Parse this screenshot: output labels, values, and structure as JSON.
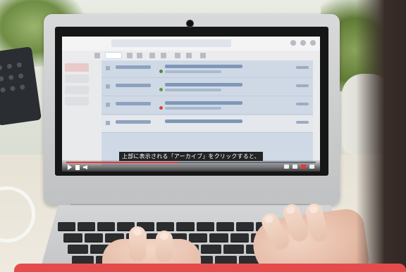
{
  "photo": {
    "subject": "laptop-playing-video-tutorial"
  },
  "screen": {
    "app_name": "",
    "search_placeholder": "",
    "subtitle": "上部に表示される「アーカイブ」をクリックすると、",
    "video_progress_fraction": 0.45,
    "time_display": ""
  },
  "colors": {
    "subtitle_bg": "#0a0a0a",
    "subtitle_text": "#ffffff",
    "progress": "#e53935",
    "selected_rows": "#cfd9e6",
    "bottom_bar": "#e44c4c"
  },
  "icons": [
    "play-icon",
    "next-icon",
    "volume-icon",
    "settings-icon",
    "youtube-icon",
    "fullscreen-icon",
    "webcam-icon"
  ]
}
